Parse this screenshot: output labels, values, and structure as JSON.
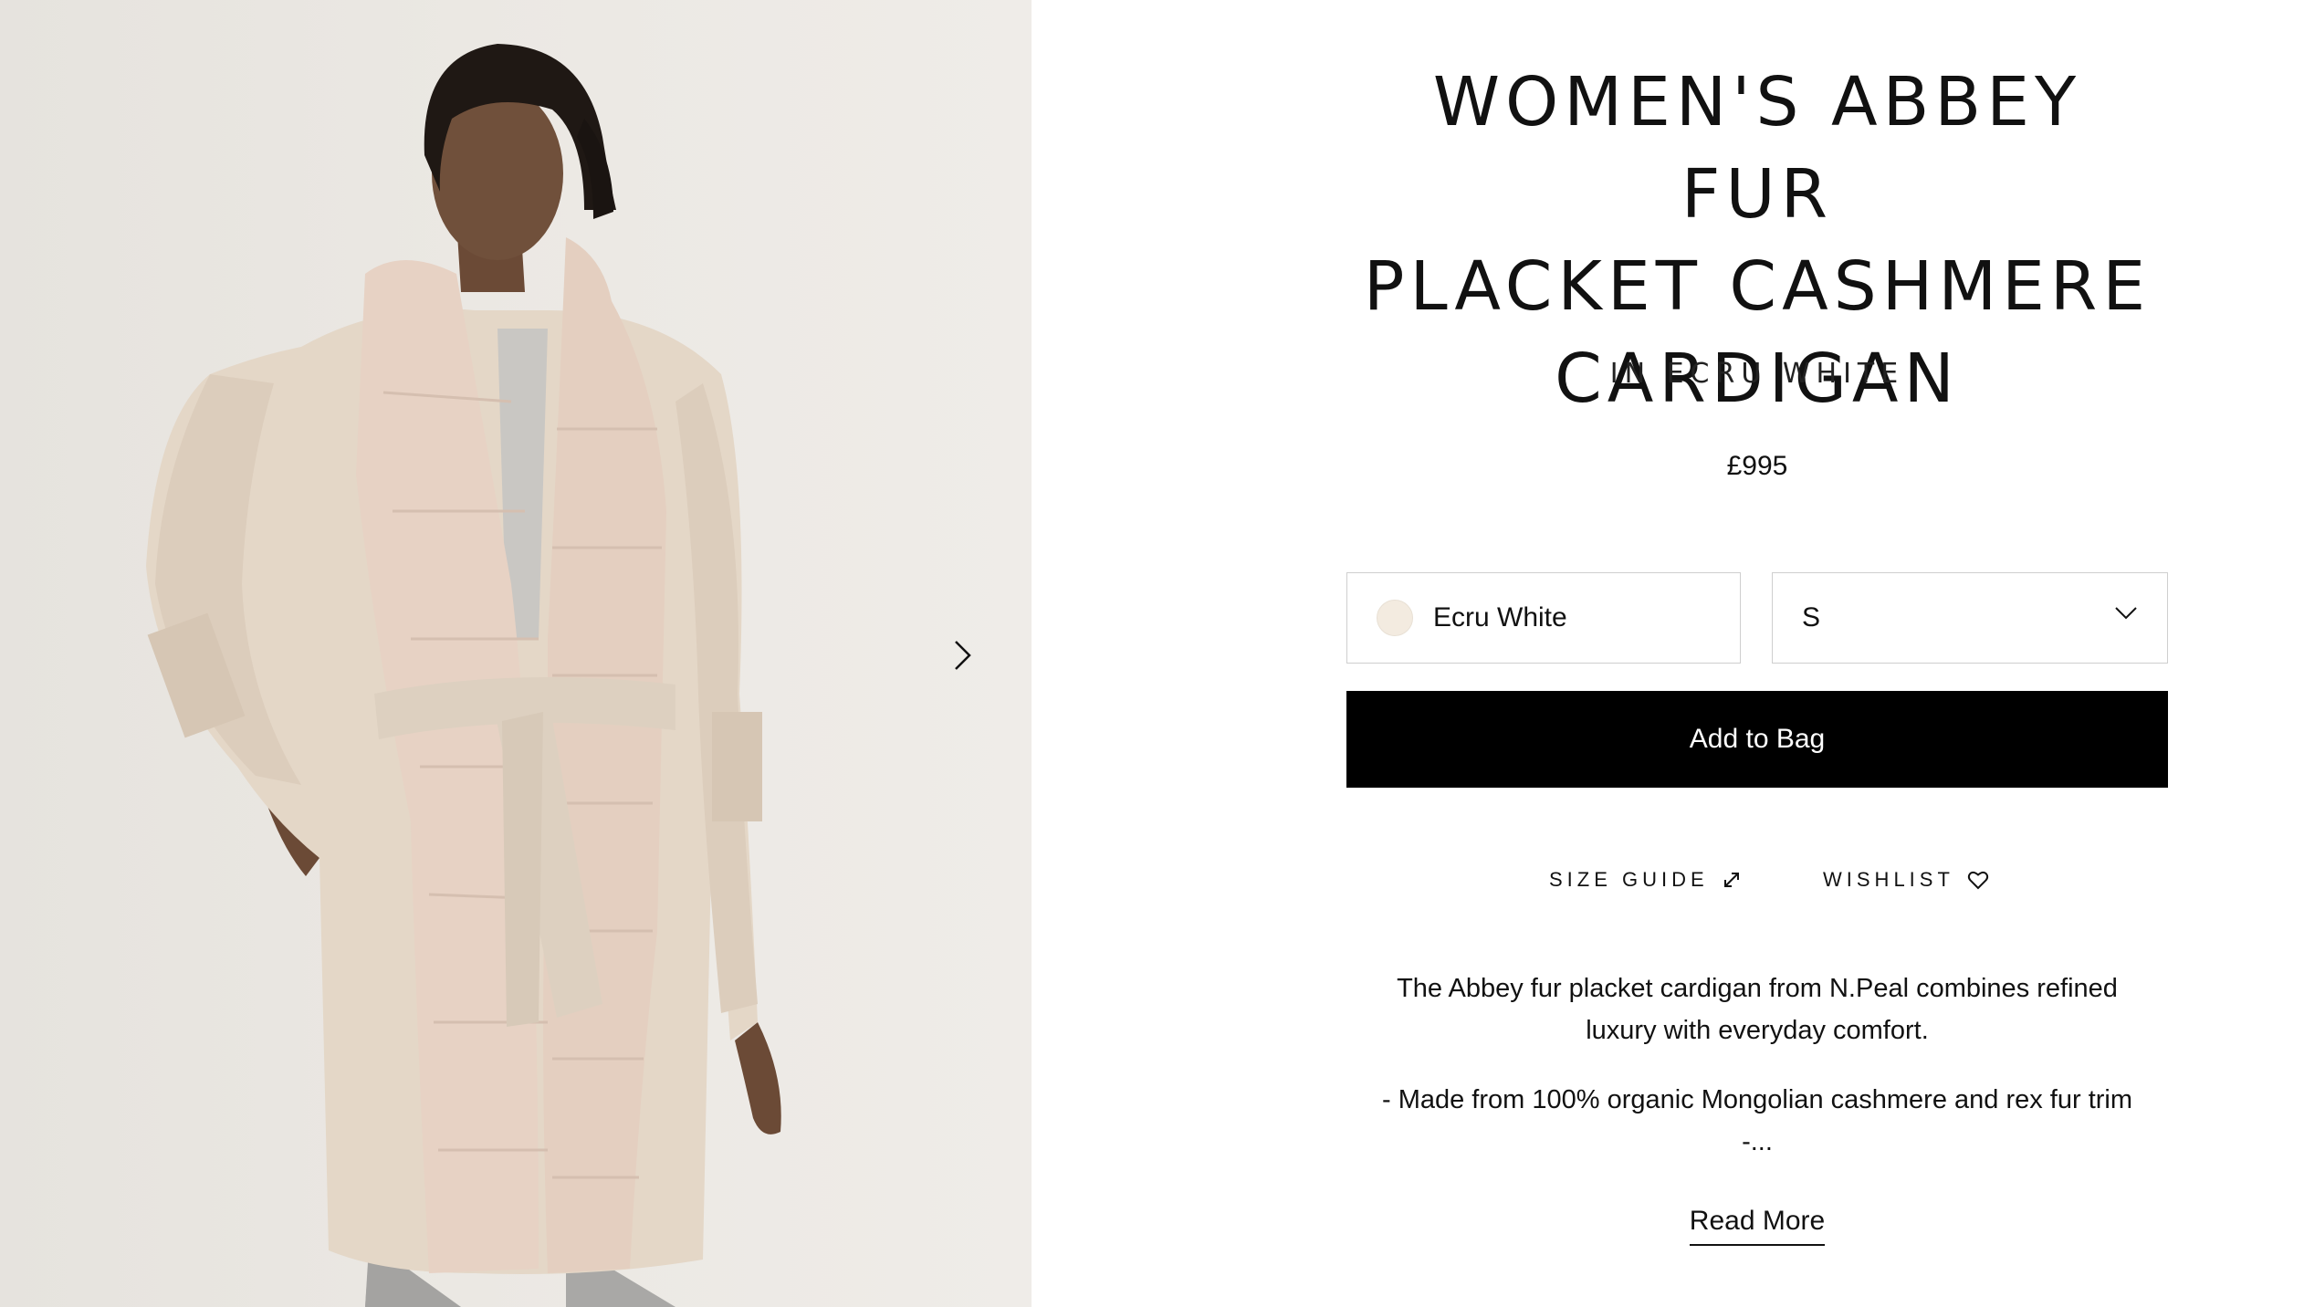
{
  "gallery": {
    "image_alt": "Model wearing ecru white cashmere cardigan with fur placket",
    "next_icon": "chevron-right-icon"
  },
  "product": {
    "title_line1": "WOMEN'S ABBEY FUR",
    "title_line2": "PLACKET CASHMERE",
    "title_line3": "CARDIGAN",
    "colour_heading": "IN ECRU WHITE",
    "price": "£995"
  },
  "options": {
    "colour": {
      "selected": "Ecru White",
      "swatch_color": "#f3ebe0"
    },
    "size": {
      "selected": "S",
      "icon": "chevron-down-icon"
    }
  },
  "add_to_bag_label": "Add to Bag",
  "actions": {
    "size_guide_label": "SIZE GUIDE",
    "size_guide_icon": "expand-icon",
    "wishlist_label": "WISHLIST",
    "wishlist_icon": "heart-icon"
  },
  "description": {
    "intro": "The Abbey fur placket cardigan from N.Peal combines refined luxury with everyday comfort.",
    "bullet_1": "- Made from 100% organic Mongolian cashmere and rex fur trim",
    "bullet_2": "-..."
  },
  "read_more_label": "Read More",
  "colors": {
    "accent": "#000000",
    "border": "#cfcfcf",
    "garment": "#e2d2c1"
  }
}
